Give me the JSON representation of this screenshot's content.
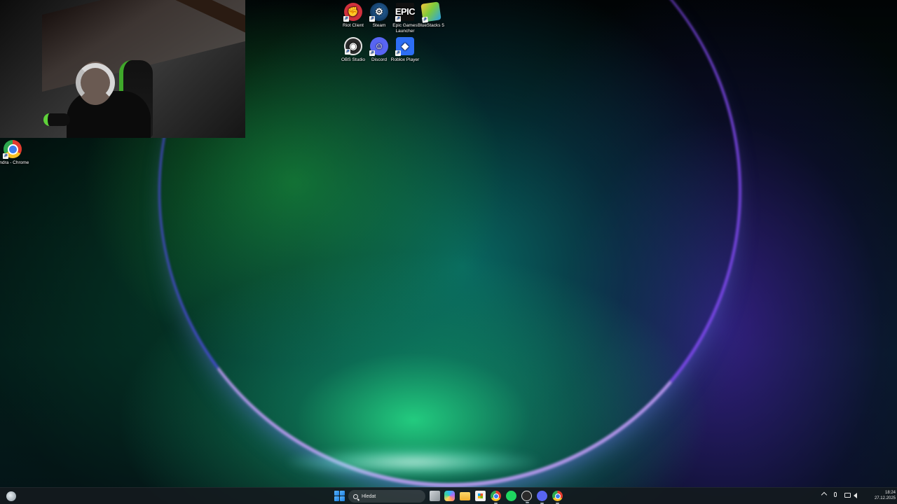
{
  "desktop": {
    "icons": [
      {
        "label": "Riot Client",
        "glyph": "✊",
        "icon": "riot-client-icon"
      },
      {
        "label": "Steam",
        "glyph": "⚙",
        "icon": "steam-icon"
      },
      {
        "label": "Epic Games Launcher",
        "glyph": "EPIC",
        "icon": "epic-games-icon"
      },
      {
        "label": "BlueStacks 5",
        "glyph": "",
        "icon": "bluestacks-icon"
      },
      {
        "label": "OBS Studio",
        "glyph": "◉",
        "icon": "obs-studio-icon"
      },
      {
        "label": "Discord",
        "glyph": "☺",
        "icon": "discord-icon"
      },
      {
        "label": "Roblox Player",
        "glyph": "◆",
        "icon": "roblox-icon"
      },
      {
        "label": "Jindra - Chrome",
        "glyph": "",
        "icon": "chrome-profile-icon"
      }
    ],
    "shortcut_arrow": "↗"
  },
  "taskbar": {
    "search_placeholder": "Hledat",
    "apps": [
      {
        "name": "task-view",
        "running": false
      },
      {
        "name": "copilot",
        "running": false
      },
      {
        "name": "file-explorer",
        "running": false
      },
      {
        "name": "microsoft-store",
        "running": false
      },
      {
        "name": "chrome",
        "running": true
      },
      {
        "name": "spotify",
        "running": false
      },
      {
        "name": "riot-client",
        "running": true
      },
      {
        "name": "discord",
        "running": true
      },
      {
        "name": "chrome-profile",
        "running": true
      }
    ],
    "tray": {
      "time": "18:24",
      "date": "27.12.2025"
    }
  },
  "colors": {
    "accent": "#1d7fe0",
    "taskbar": "#141a1e"
  }
}
